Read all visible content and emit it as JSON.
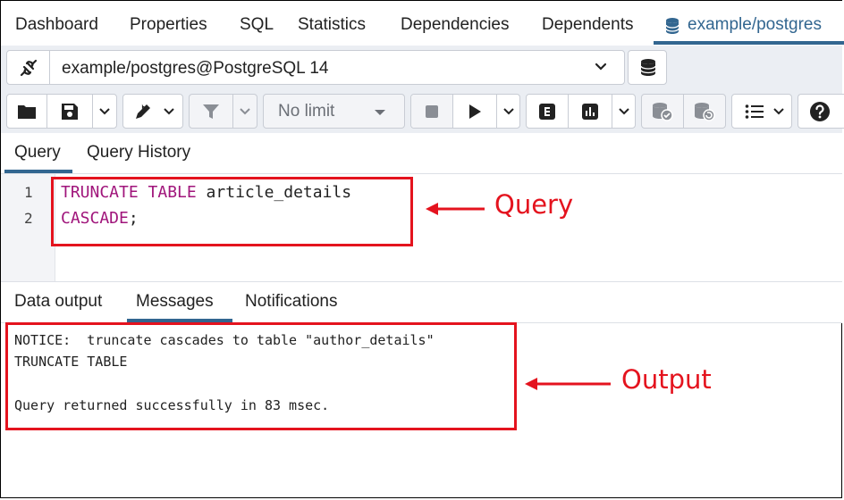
{
  "top_tabs": [
    "Dashboard",
    "Properties",
    "SQL",
    "Statistics",
    "Dependencies",
    "Dependents"
  ],
  "active_tab": "example/postgres",
  "connection": {
    "label": "example/postgres@PostgreSQL 14"
  },
  "toolbar": {
    "limit_label": "No limit"
  },
  "query_tabs": [
    "Query",
    "Query History"
  ],
  "editor": {
    "line_numbers": [
      "1",
      "2"
    ],
    "line1_kw": "TRUNCATE TABLE",
    "line1_rest": " article_details",
    "line2_kw": "CASCADE",
    "line2_rest": ";"
  },
  "output_tabs": [
    "Data output",
    "Messages",
    "Notifications"
  ],
  "messages": [
    "NOTICE:  truncate cascades to table \"author_details\"",
    "TRUNCATE TABLE",
    "",
    "Query returned successfully in 83 msec."
  ],
  "annotations": {
    "query_label": "Query",
    "output_label": "Output"
  },
  "colors": {
    "accent": "#326690",
    "annotation": "#e4131e",
    "keyword": "#a0157b",
    "toolbar_bg": "#ebeef3"
  },
  "icons": [
    "connection-plug-icon",
    "database-icon",
    "folder-icon",
    "save-icon",
    "pencil-icon",
    "filter-icon",
    "stop-icon",
    "play-icon",
    "explain-icon",
    "explain-analyze-icon",
    "commit-icon",
    "rollback-icon",
    "macros-icon",
    "help-icon"
  ]
}
